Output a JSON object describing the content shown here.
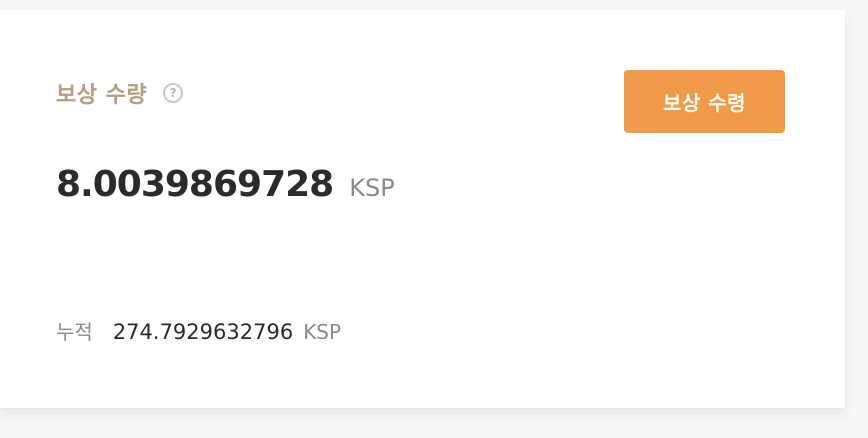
{
  "reward": {
    "title": "보상 수량",
    "help_icon": "question-circle-icon",
    "claim_button_label": "보상 수령",
    "amount": "8.0039869728",
    "amount_unit": "KSP",
    "cumulative_label": "누적",
    "cumulative_amount": "274.7929632796",
    "cumulative_unit": "KSP"
  },
  "colors": {
    "title": "#b39d84",
    "button_bg": "#f19a48",
    "button_text": "#ffffff",
    "amount_text": "#2b2b2b",
    "unit_text": "#8a8a8a"
  }
}
